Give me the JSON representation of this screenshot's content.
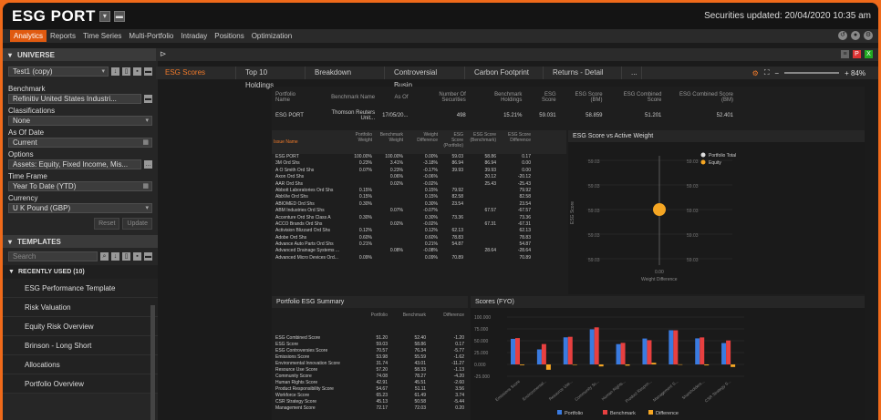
{
  "app": {
    "title": "ESG PORT",
    "updated": "Securities updated: 20/04/2020 10:35 am"
  },
  "menu": [
    "Analytics",
    "Reports",
    "Time Series",
    "Multi-Portfolio",
    "Intraday",
    "Positions",
    "Optimization"
  ],
  "universe": {
    "header": "UNIVERSE",
    "portfolio": "Test1 (copy)",
    "benchmark_label": "Benchmark",
    "benchmark": "Refinitiv United States Industri...",
    "classifications_label": "Classifications",
    "classifications": "None",
    "asof_label": "As Of Date",
    "asof": "Current",
    "options_label": "Options",
    "options": "Assets: Equity, Fixed Income, Mis...",
    "timeframe_label": "Time Frame",
    "timeframe": "Year To Date (YTD)",
    "currency_label": "Currency",
    "currency": "U K Pound (GBP)",
    "reset": "Reset",
    "update": "Update"
  },
  "templates": {
    "header": "TEMPLATES",
    "search_placeholder": "Search",
    "recent": "RECENTLY USED (10)",
    "items": [
      "ESG Performance Template",
      "Risk Valuation",
      "Equity Risk Overview",
      "Brinson - Long Short",
      "Allocations",
      "Portfolio Overview"
    ]
  },
  "tabs": [
    "ESG Scores",
    "Top 10 Holdings",
    "Breakdown",
    "Controversial Busin...",
    "Carbon Footprint",
    "Returns - Detail",
    "..."
  ],
  "zoom": "+ 84%",
  "portfolio_table": {
    "headers": [
      "Portfolio Name",
      "Benchmark Name",
      "As Of",
      "Number Of Securities",
      "Benchmark Holdings",
      "ESG Score",
      "ESG Score (BM)",
      "ESG Combined Score",
      "ESG Combined Score (BM)"
    ],
    "row": [
      "ESG PORT",
      "Thomson Reuters Unit...",
      "17/05/20...",
      "498",
      "15.21%",
      "59.031",
      "58.859",
      "51.201",
      "52.401"
    ]
  },
  "holdings": {
    "headers": [
      "Issue Name",
      "Portfolio Weight",
      "Benchmark Weight",
      "Weight Difference",
      "ESG Score (Portfolio)",
      "ESG Score (Benchmark)",
      "ESG Score Difference"
    ],
    "rows": [
      [
        "ESG PORT",
        "100.00%",
        "100.00%",
        "0.00%",
        "59.03",
        "58.86",
        "0.17"
      ],
      [
        "3M Ord Shs",
        "0.23%",
        "3.41%",
        "-3.18%",
        "86.94",
        "86.94",
        "0.00"
      ],
      [
        "A O Smith Ord Shs",
        "0.07%",
        "0.23%",
        "-0.17%",
        "39.93",
        "39.93",
        "0.00"
      ],
      [
        "Axon Ord Shs",
        "",
        "0.06%",
        "-0.06%",
        "",
        "20.12",
        "-20.12"
      ],
      [
        "AAR Ord Shs",
        "",
        "0.02%",
        "-0.02%",
        "",
        "25.43",
        "-25.43"
      ],
      [
        "Abbott Laboratories Ord Shs",
        "0.15%",
        "",
        "0.15%",
        "79.92",
        "",
        "79.92"
      ],
      [
        "AbbVie Ord Shs",
        "0.15%",
        "",
        "0.15%",
        "82.58",
        "",
        "82.58"
      ],
      [
        "ABIOMED Ord Shs",
        "0.30%",
        "",
        "0.30%",
        "23.54",
        "",
        "23.54"
      ],
      [
        "ABM Industries Ord Shs",
        "",
        "0.07%",
        "-0.07%",
        "",
        "67.57",
        "-67.57"
      ],
      [
        "Accenture Ord Shs Class A",
        "0.30%",
        "",
        "0.30%",
        "73.36",
        "",
        "73.36"
      ],
      [
        "ACCO Brands Ord Shs",
        "",
        "0.02%",
        "-0.02%",
        "",
        "67.31",
        "-67.31"
      ],
      [
        "Activision Blizzard Ord Shs",
        "0.12%",
        "",
        "0.12%",
        "62.13",
        "",
        "62.13"
      ],
      [
        "Adobe Ord Shs",
        "0.60%",
        "",
        "0.60%",
        "78.83",
        "",
        "78.83"
      ],
      [
        "Advance Auto Parts Ord Shs",
        "0.21%",
        "",
        "0.21%",
        "54.87",
        "",
        "54.87"
      ],
      [
        "Advanced Drainage Systems ...",
        "",
        "0.08%",
        "-0.08%",
        "",
        "28.64",
        "-28.64"
      ],
      [
        "Advanced Micro Devices Ord...",
        "0.09%",
        "",
        "0.09%",
        "70.89",
        "",
        "70.89"
      ]
    ]
  },
  "scatter": {
    "title": "ESG Score vs Active Weight",
    "ylabel": "ESG Score",
    "xlabel": "Weight Difference",
    "xtick": "0.00",
    "ytick": "59.03",
    "legend": [
      "Portfolio Total",
      "Equity"
    ],
    "legend_colors": [
      "#dddddd",
      "#f5a623"
    ]
  },
  "summary": {
    "title": "Portfolio ESG Summary",
    "headers": [
      "",
      "Portfolio",
      "Benchmark",
      "Difference"
    ],
    "rows": [
      [
        "ESG Combined Score",
        "51.20",
        "52.40",
        "-1.20"
      ],
      [
        "ESG Score",
        "59.03",
        "58.86",
        "0.17"
      ],
      [
        "ESG Controversies Score",
        "70.57",
        "76.34",
        "-5.77"
      ],
      [
        "Emissions Score",
        "53.98",
        "55.59",
        "-1.62"
      ],
      [
        "Environmental Innovation Score",
        "31.74",
        "43.01",
        "-11.27"
      ],
      [
        "Resource Use Score",
        "57.20",
        "58.33",
        "-1.13"
      ],
      [
        "Community Score",
        "74.08",
        "78.27",
        "-4.20"
      ],
      [
        "Human Rights Score",
        "42.91",
        "45.51",
        "-2.60"
      ],
      [
        "Product Responsibility Score",
        "54.67",
        "51.11",
        "3.56"
      ],
      [
        "Workforce Score",
        "65.23",
        "61.49",
        "3.74"
      ],
      [
        "CSR Strategy Score",
        "45.13",
        "50.58",
        "-5.44"
      ],
      [
        "Management Score",
        "72.17",
        "72.03",
        "0.20"
      ]
    ]
  },
  "chart_data": {
    "type": "bar",
    "title": "Scores (FYO)",
    "categories": [
      "Emissions Score",
      "Environmental...",
      "Resource Use...",
      "Community Sc...",
      "Human Rights...",
      "Product Respon...",
      "Management S...",
      "Shareholders...",
      "CSR Strategy S..."
    ],
    "series": [
      {
        "name": "Portfolio",
        "values": [
          53.98,
          31.74,
          57.2,
          74.08,
          42.91,
          54.67,
          72.17,
          55.0,
          45.13
        ]
      },
      {
        "name": "Benchmark",
        "values": [
          55.59,
          43.01,
          58.33,
          78.27,
          45.51,
          51.11,
          72.03,
          57.0,
          50.58
        ]
      },
      {
        "name": "Difference",
        "values": [
          -1.62,
          -11.27,
          -1.13,
          -4.2,
          -2.6,
          3.56,
          0.2,
          -2.0,
          -5.44
        ]
      }
    ],
    "yticks": [
      "100.000",
      "75.000",
      "50.000",
      "25.000",
      "0.000",
      "-25.000"
    ],
    "ylim": [
      -25,
      100
    ],
    "colors": [
      "#3a7be0",
      "#e84040",
      "#f5a623"
    ]
  }
}
